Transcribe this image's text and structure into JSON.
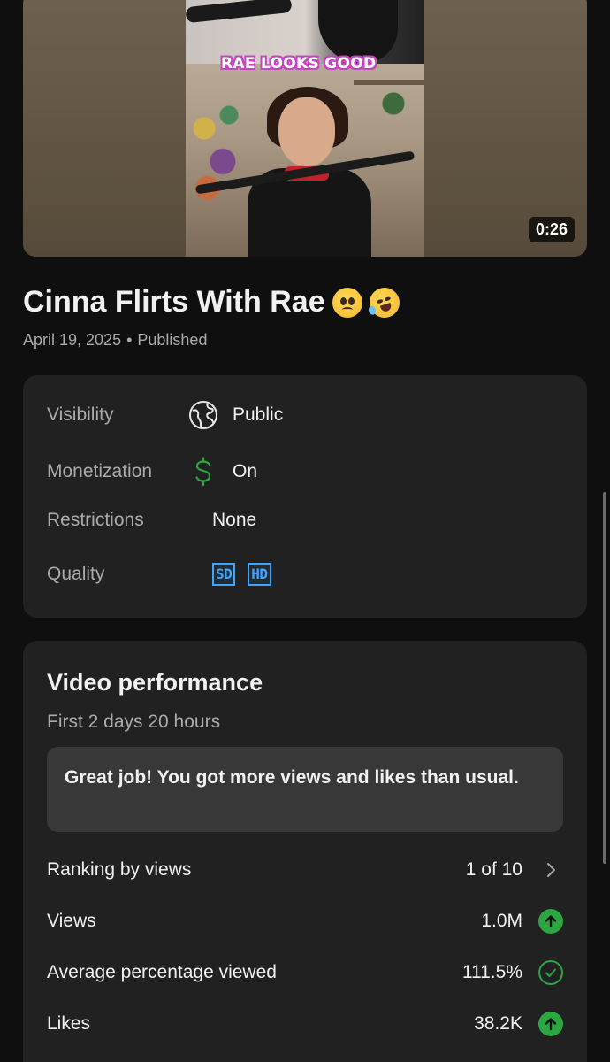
{
  "video": {
    "caption": "RAE LOOKS GOOD",
    "duration": "0:26"
  },
  "title": {
    "text": "Cinna Flirts With Rae",
    "emojis": [
      "pleading-face",
      "rolling-on-floor-laughing"
    ]
  },
  "meta": {
    "date": "April 19, 2025",
    "separator": "•",
    "status": "Published"
  },
  "details": {
    "visibility": {
      "label": "Visibility",
      "value": "Public",
      "icon": "globe-icon"
    },
    "monetization": {
      "label": "Monetization",
      "value": "On",
      "icon": "dollar-icon",
      "icon_color": "#2ba640"
    },
    "restrictions": {
      "label": "Restrictions",
      "value": "None"
    },
    "quality": {
      "label": "Quality",
      "badges": [
        "SD",
        "HD"
      ],
      "badge_color": "#3ea6ff"
    }
  },
  "performance": {
    "title": "Video performance",
    "period": "First 2 days 20 hours",
    "notice": "Great job! You got more views and likes than usual.",
    "metrics": [
      {
        "label": "Ranking by views",
        "value": "1 of 10",
        "icon": "chevron-right-icon"
      },
      {
        "label": "Views",
        "value": "1.0M",
        "icon": "arrow-up-icon"
      },
      {
        "label": "Average percentage viewed",
        "value": "111.5%",
        "icon": "check-circle-icon"
      },
      {
        "label": "Likes",
        "value": "38.2K",
        "icon": "arrow-up-icon"
      }
    ],
    "accent_color": "#2ba640"
  }
}
